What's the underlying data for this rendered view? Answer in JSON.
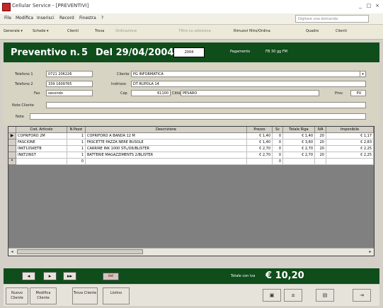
{
  "window": {
    "title": "Cellular Service - [PREVENTIVI]",
    "btn_min": "_",
    "btn_max": "□",
    "btn_close": "×"
  },
  "menu": {
    "items": [
      "File",
      "Modifica",
      "Inserisci",
      "Record",
      "Finestra",
      "?"
    ],
    "help_placeholder": "Digitare una domanda"
  },
  "toolbar": {
    "items": [
      "Generale ▾",
      "Schede ▾",
      "Clienti",
      "Trova",
      "Ordinazione",
      "Filtro su selezione",
      "Rimuovi filtro/Ordina",
      "Quadro",
      "Clienti"
    ]
  },
  "header": {
    "title": "Preventivo n.",
    "number": "5",
    "date": "Del 29/04/2004",
    "year": "2004",
    "payment_label": "Pagamento",
    "payment_value": "FB 30 gg FM"
  },
  "form": {
    "tel1_label": "Telefono 1",
    "tel1": "0721 206226",
    "tel2_label": "Telefono 2",
    "tel2": "339 1609765",
    "fax_label": "Fax",
    "fax": "secondo",
    "cliente_label": "Cliente",
    "cliente": "PG INFORMATICA",
    "indirizzo_label": "Indirizzo",
    "indirizzo": "DT RUPOLA 14",
    "cap_label": "Cap",
    "cap": "61100",
    "citta_label": "Città",
    "citta": "PESARO",
    "prov_label": "Prov.",
    "prov": "PU",
    "note_cliente_label": "Note Cliente",
    "note_label": "Note"
  },
  "grid": {
    "headers": [
      "Cod. Articolo",
      "N.Pezzi",
      "Descrizione",
      "Prezzo",
      "Sc",
      "Totale Riga",
      "IVA",
      "Imponibile"
    ],
    "rows": [
      [
        "COPRIFORO 2M",
        "1",
        "COPRIFORO A BANDA 12 M",
        "€ 1,40",
        "0",
        "€ 1,40",
        "20",
        "€ 1,17"
      ],
      [
        "FASCIONE",
        "1",
        "FASCETTE PAZZA NERE BUSOLE",
        "€ 1,40",
        "0",
        "€ 3,60",
        "20",
        "€ 2,83"
      ],
      [
        "INKT10SKETB",
        "1",
        "CARRIRE INK 1000 STL/O6/BLISTER",
        "€ 2,70",
        "0",
        "€ 2,70",
        "20",
        "€ 2,25"
      ],
      [
        "INKT2INST",
        "1",
        "BATTERIE MAGAZZIMENTS 2/BLISTER",
        "€ 2,70",
        "0",
        "€ 2,70",
        "20",
        "€ 2,25"
      ]
    ],
    "new_row_pieces": "0",
    "new_row_sc": "0"
  },
  "footer": {
    "nav_first": "◂",
    "nav_next": "▸",
    "nav_last": "▸▸",
    "red_btn": "del",
    "total_label": "Totale con iva",
    "total_value": "€ 10,20"
  },
  "buttons": {
    "nuovo": "Nuovo Cliente",
    "modifica": "Modifica Cliente",
    "trova": "Trova Cliente",
    "listino": "Listino"
  },
  "colors": {
    "header_bg": "#0f4d1b",
    "form_bg": "#d8d4c4",
    "grid_bg": "#808080"
  }
}
